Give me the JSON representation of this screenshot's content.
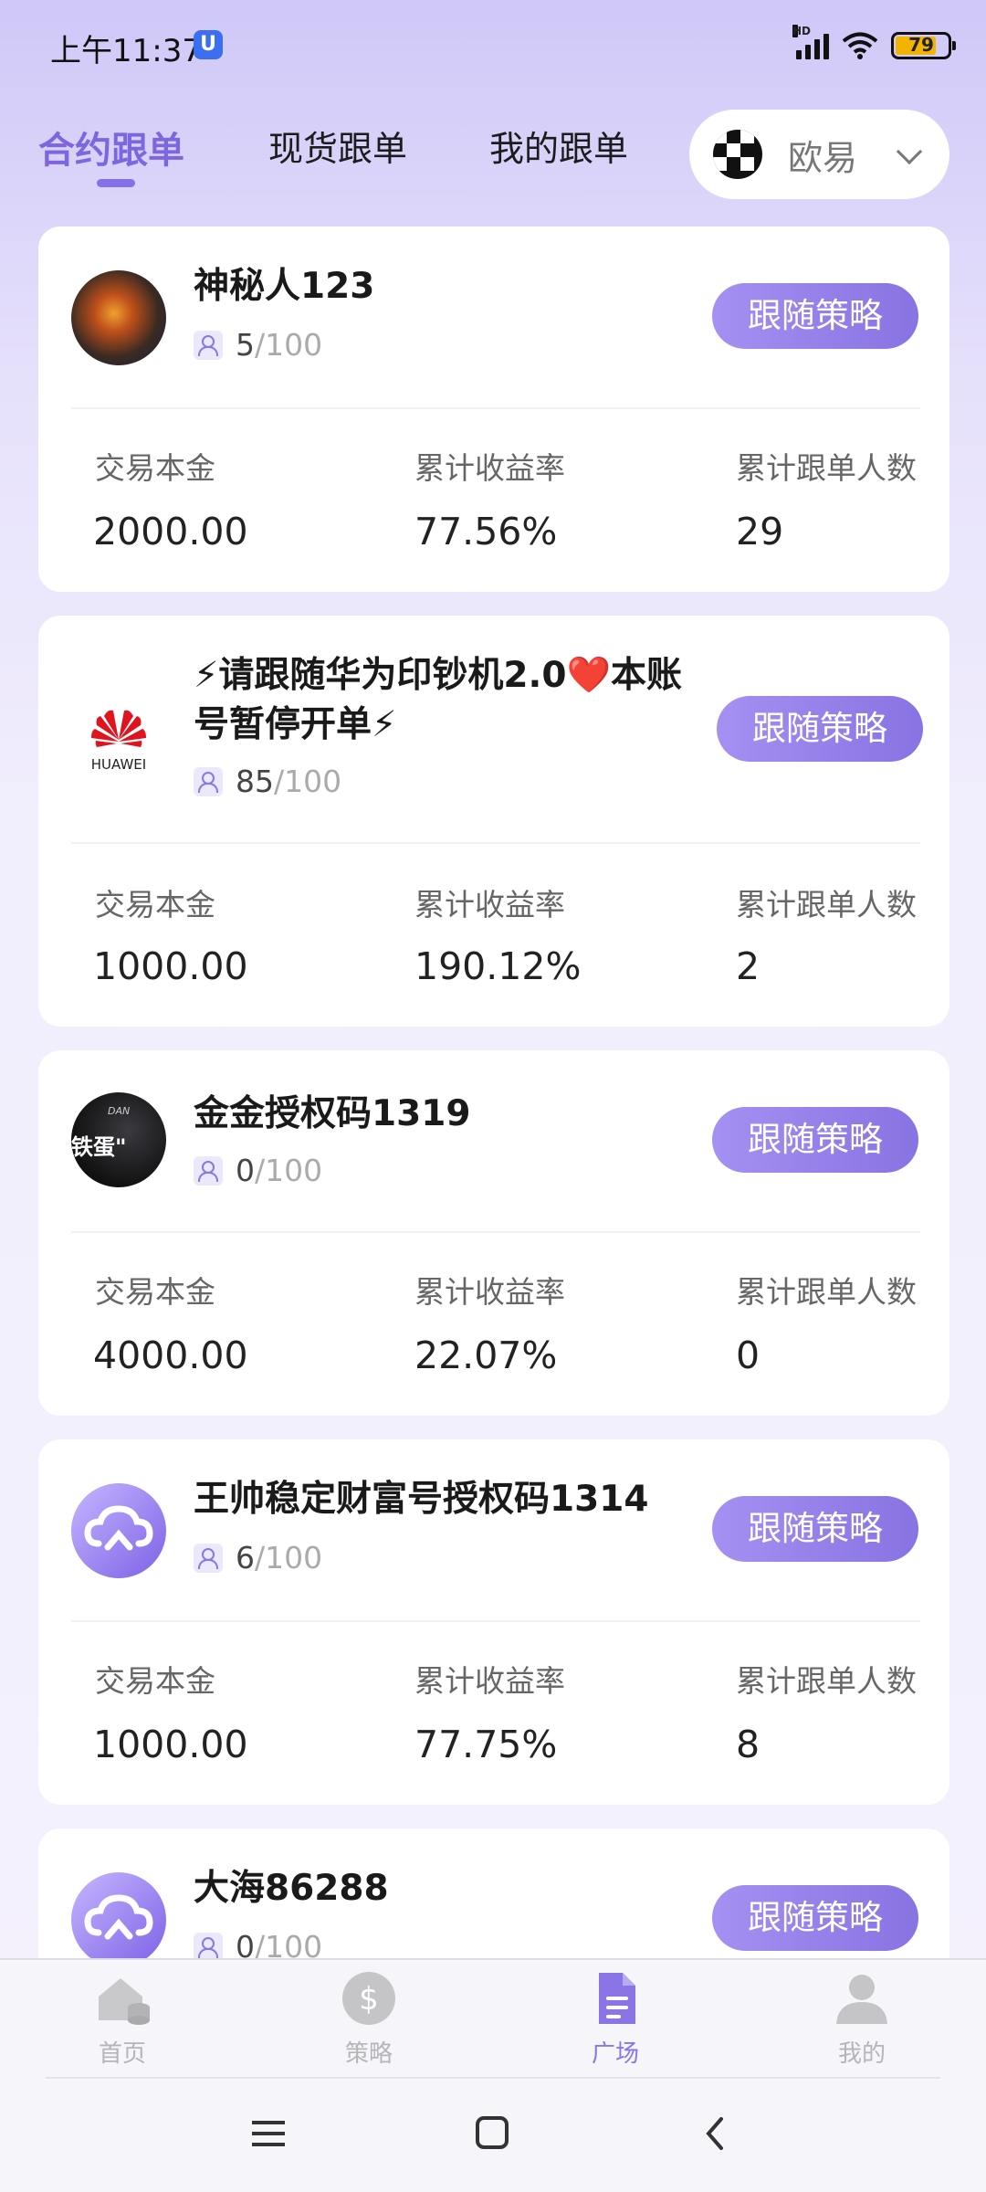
{
  "status_bar": {
    "time": "上午11:37",
    "hd_label": "HD",
    "battery": "79",
    "icons": [
      "shield-icon",
      "signal-icon",
      "wifi-icon",
      "battery-icon"
    ]
  },
  "tabs": [
    {
      "label": "合约跟单",
      "active": true
    },
    {
      "label": "现货跟单",
      "active": false
    },
    {
      "label": "我的跟单",
      "active": false
    }
  ],
  "exchange": {
    "label": "欧易",
    "icon": "okx-logo-icon"
  },
  "stat_labels": {
    "capital": "交易本金",
    "yield": "累计收益率",
    "followers": "累计跟单人数"
  },
  "follow_label": "跟随策略",
  "cards": [
    {
      "name": "神秘人123",
      "followers": "5",
      "max": "/100",
      "capital": "2000.00",
      "yield": "77.56%",
      "follower_total": "29",
      "avatar": "fire-bull-avatar"
    },
    {
      "name": "⚡请跟随华为印钞机2.0❤️本账号暂停开单⚡",
      "name_line1": "⚡请跟随华为印钞机2.0❤️本账",
      "name_line2": "号暂停开单⚡",
      "followers": "85",
      "max": "/100",
      "capital": "1000.00",
      "yield": "190.12%",
      "follower_total": "2",
      "avatar": "huawei-logo",
      "avatar_text": "HUAWEI"
    },
    {
      "name": "金金授权码1319",
      "followers": "0",
      "max": "/100",
      "capital": "4000.00",
      "yield": "22.07%",
      "follower_total": "0",
      "avatar": "dark-photo-avatar",
      "avatar_text_top": "DAN",
      "avatar_text_main": "铁蛋\""
    },
    {
      "name": "王帅稳定财富号授权码1314",
      "followers": "6",
      "max": "/100",
      "capital": "1000.00",
      "yield": "77.75%",
      "follower_total": "8",
      "avatar": "cloud-logo-avatar"
    },
    {
      "name": "大海86288",
      "followers": "0",
      "max": "/100",
      "avatar": "cloud-logo-avatar"
    }
  ],
  "bottom_nav": [
    {
      "label": "首页",
      "icon": "home-icon",
      "active": false
    },
    {
      "label": "策略",
      "icon": "dollar-icon",
      "active": false
    },
    {
      "label": "广场",
      "icon": "document-icon",
      "active": true
    },
    {
      "label": "我的",
      "icon": "user-icon",
      "active": false
    }
  ],
  "system_nav": [
    "menu-icon",
    "home-square-icon",
    "back-icon"
  ],
  "colors": {
    "accent": "#8570e8",
    "button_start": "#a590f2",
    "button_end": "#8873e2"
  }
}
